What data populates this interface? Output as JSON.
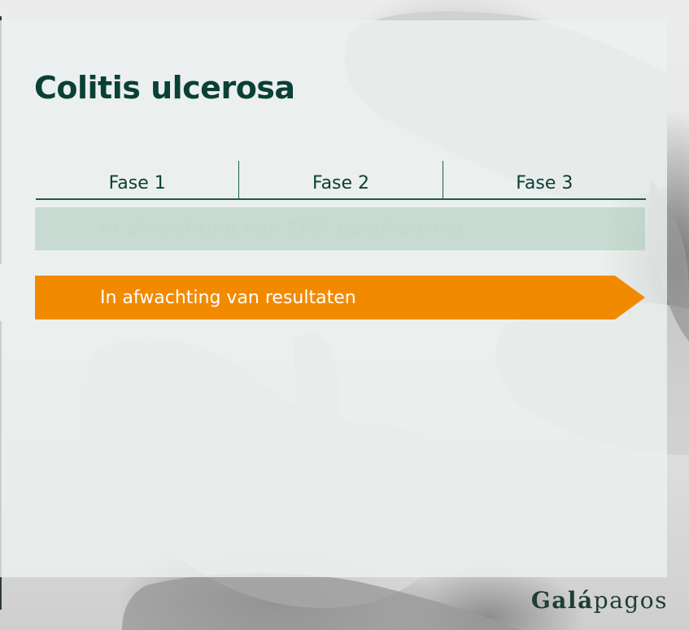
{
  "slide": {
    "title": "Colitis ulcerosa"
  },
  "phases": [
    "Fase 1",
    "Fase 2",
    "Fase 3"
  ],
  "bars": {
    "ema": "In afwachting van EMA goedkeuring",
    "results": "In afwachting van resultaten"
  },
  "logo": {
    "bold_part": "Galá",
    "light_part": "pagos"
  },
  "colors": {
    "title": "#0b4034",
    "accent": "#f28a00",
    "ema_bar": "#96beaa"
  }
}
